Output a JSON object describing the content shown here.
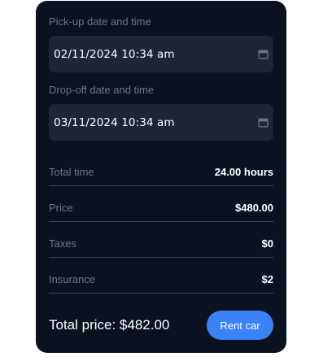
{
  "pickup": {
    "label": "Pick-up date and time",
    "value": "02/11/2024 10:34 am"
  },
  "dropoff": {
    "label": "Drop-off date and time",
    "value": "03/11/2024 10:34 am"
  },
  "summary": [
    {
      "label": "Total time",
      "value": "24.00 hours"
    },
    {
      "label": "Price",
      "value": "$480.00"
    },
    {
      "label": "Taxes",
      "value": "$0"
    },
    {
      "label": "Insurance",
      "value": "$2"
    }
  ],
  "total": {
    "text": "Total price: $482.00"
  },
  "actions": {
    "rent_label": "Rent car"
  },
  "colors": {
    "card_background": "#0b1120",
    "input_background": "#1e2535",
    "accent": "#3b82f6",
    "muted_text": "#6b7589"
  },
  "icons": {
    "date_picker": "calendar-icon"
  }
}
